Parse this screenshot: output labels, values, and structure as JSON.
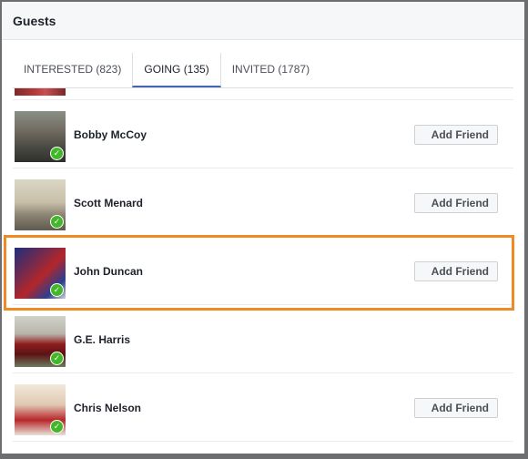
{
  "dialog": {
    "title": "Guests"
  },
  "tabs": [
    {
      "label": "INTERESTED (823)",
      "active": false
    },
    {
      "label": "GOING (135)",
      "active": true
    },
    {
      "label": "INVITED (1787)",
      "active": false
    }
  ],
  "guests": [
    {
      "name": "Bobby McCoy",
      "button": "Add Friend"
    },
    {
      "name": "Scott Menard",
      "button": "Add Friend"
    },
    {
      "name": "John Duncan",
      "button": "Add Friend"
    },
    {
      "name": "G.E. Harris",
      "button": null
    },
    {
      "name": "Chris Nelson",
      "button": "Add Friend"
    }
  ],
  "colors": {
    "highlight": "#f08a24",
    "check": "#42b72a",
    "active_tab": "#4267b2"
  },
  "icons": {
    "going_badge": "check-icon"
  }
}
